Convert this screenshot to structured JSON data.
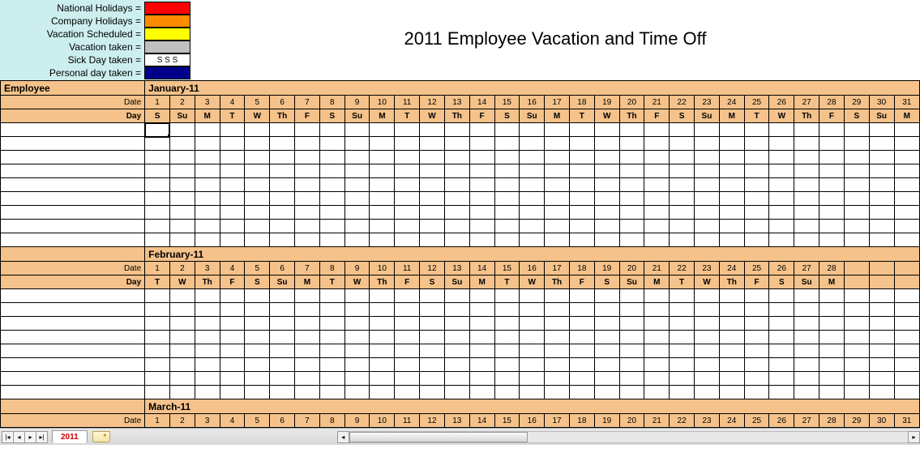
{
  "title": "2011 Employee Vacation and Time Off",
  "legend": [
    {
      "label": "National Holidays =",
      "color": "#ff0000",
      "text": ""
    },
    {
      "label": "Company Holidays =",
      "color": "#ff8c00",
      "text": ""
    },
    {
      "label": "Vacation Scheduled =",
      "color": "#ffff00",
      "text": ""
    },
    {
      "label": "Vacation taken =",
      "color": "#bfbfbf",
      "text": ""
    },
    {
      "label": "Sick Day taken =",
      "color": "#ffffff",
      "text": "S   S   S"
    },
    {
      "label": "Personal day taken =",
      "color": "#00008b",
      "text": ""
    }
  ],
  "employee_header": "Employee",
  "row_labels": {
    "date": "Date",
    "day": "Day"
  },
  "months": [
    {
      "name": "January-11",
      "dates": [
        "1",
        "2",
        "3",
        "4",
        "5",
        "6",
        "7",
        "8",
        "9",
        "10",
        "11",
        "12",
        "13",
        "14",
        "15",
        "16",
        "17",
        "18",
        "19",
        "20",
        "21",
        "22",
        "23",
        "24",
        "25",
        "26",
        "27",
        "28",
        "29",
        "30",
        "31"
      ],
      "days": [
        "S",
        "Su",
        "M",
        "T",
        "W",
        "Th",
        "F",
        "S",
        "Su",
        "M",
        "T",
        "W",
        "Th",
        "F",
        "S",
        "Su",
        "M",
        "T",
        "W",
        "Th",
        "F",
        "S",
        "Su",
        "M",
        "T",
        "W",
        "Th",
        "F",
        "S",
        "Su",
        "M"
      ],
      "data_rows": 9
    },
    {
      "name": "February-11",
      "dates": [
        "1",
        "2",
        "3",
        "4",
        "5",
        "6",
        "7",
        "8",
        "9",
        "10",
        "11",
        "12",
        "13",
        "14",
        "15",
        "16",
        "17",
        "18",
        "19",
        "20",
        "21",
        "22",
        "23",
        "24",
        "25",
        "26",
        "27",
        "28",
        "",
        "",
        ""
      ],
      "days": [
        "T",
        "W",
        "Th",
        "F",
        "S",
        "Su",
        "M",
        "T",
        "W",
        "Th",
        "F",
        "S",
        "Su",
        "M",
        "T",
        "W",
        "Th",
        "F",
        "S",
        "Su",
        "M",
        "T",
        "W",
        "Th",
        "F",
        "S",
        "Su",
        "M",
        "",
        "",
        ""
      ],
      "data_rows": 8
    },
    {
      "name": "March-11",
      "dates": [
        "1",
        "2",
        "3",
        "4",
        "5",
        "6",
        "7",
        "8",
        "9",
        "10",
        "11",
        "12",
        "13",
        "14",
        "15",
        "16",
        "17",
        "18",
        "19",
        "20",
        "21",
        "22",
        "23",
        "24",
        "25",
        "26",
        "27",
        "28",
        "29",
        "30",
        "31"
      ],
      "days": [],
      "data_rows": 0
    }
  ],
  "tab": {
    "active": "2011"
  },
  "selected_cell": {
    "month_index": 0,
    "row": 0,
    "col": 0
  }
}
